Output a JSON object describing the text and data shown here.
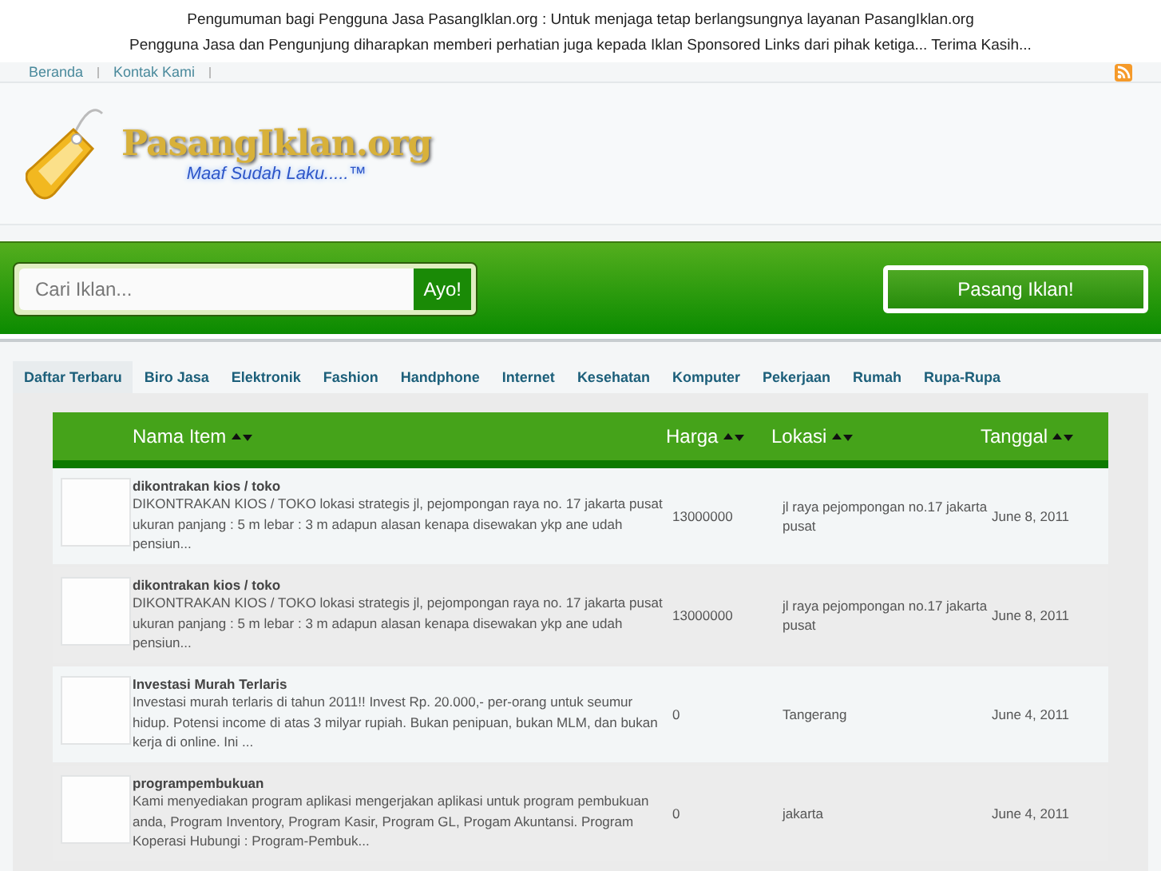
{
  "announcement": [
    "Pengumuman bagi Pengguna Jasa PasangIklan.org : Untuk menjaga tetap berlangsungnya layanan PasangIklan.org",
    "Pengguna Jasa dan Pengunjung diharapkan memberi perhatian juga kepada Iklan Sponsored Links dari pihak ketiga... Terima Kasih..."
  ],
  "nav": [
    "Beranda",
    "Kontak Kami"
  ],
  "logo": {
    "title": "PasangIklan.org",
    "tagline": "Maaf Sudah Laku.....™"
  },
  "search": {
    "placeholder": "Cari Iklan...",
    "button": "Ayo!"
  },
  "post_button": "Pasang Iklan!",
  "tabs": [
    {
      "label": "Daftar Terbaru",
      "selected": true
    },
    {
      "label": "Biro Jasa",
      "selected": false
    },
    {
      "label": "Elektronik",
      "selected": false
    },
    {
      "label": "Fashion",
      "selected": false
    },
    {
      "label": "Handphone",
      "selected": false
    },
    {
      "label": "Internet",
      "selected": false
    },
    {
      "label": "Kesehatan",
      "selected": false
    },
    {
      "label": "Komputer",
      "selected": false
    },
    {
      "label": "Pekerjaan",
      "selected": false
    },
    {
      "label": "Rumah",
      "selected": false
    },
    {
      "label": "Rupa-Rupa",
      "selected": false
    }
  ],
  "table": {
    "columns": [
      "Nama Item",
      "Harga",
      "Lokasi",
      "Tanggal"
    ],
    "rows": [
      {
        "title": "dikontrakan kios / toko",
        "description": "DIKONTRAKAN KIOS / TOKO lokasi strategis jl, pejompongan raya no. 17 jakarta pusat ukuran panjang : 5 m lebar : 3 m adapun alasan kenapa disewakan ykp ane udah pensiun...",
        "price": "13000000",
        "location": "jl raya pejompongan no.17 jakarta pusat",
        "date": "June 8, 2011"
      },
      {
        "title": "dikontrakan kios / toko",
        "description": "DIKONTRAKAN KIOS / TOKO lokasi strategis jl, pejompongan raya no. 17 jakarta pusat ukuran panjang : 5 m lebar : 3 m adapun alasan kenapa disewakan ykp ane udah pensiun...",
        "price": "13000000",
        "location": "jl raya pejompongan no.17 jakarta pusat",
        "date": "June 8, 2011"
      },
      {
        "title": "Investasi Murah Terlaris",
        "description": "Investasi murah terlaris di tahun 2011!! Invest Rp. 20.000,- per-orang untuk seumur hidup. Potensi income di atas 3 milyar rupiah. Bukan penipuan, bukan MLM, dan bukan kerja di online. Ini ...",
        "price": "0",
        "location": "Tangerang",
        "date": "June 4, 2011"
      },
      {
        "title": "programpembukuan",
        "description": "Kami menyediakan program aplikasi mengerjakan aplikasi untuk program pembukuan anda, Program Inventory, Program Kasir, Program GL, Progam Akuntansi. Program Koperasi Hubungi : Program-Pembuk...",
        "price": "0",
        "location": "jakarta",
        "date": "June 4, 2011"
      }
    ]
  }
}
